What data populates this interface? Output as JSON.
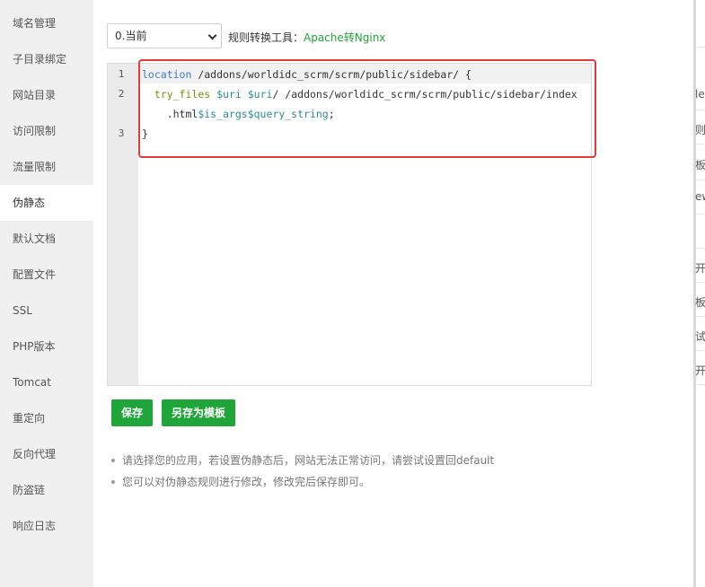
{
  "sidebar": {
    "items": [
      {
        "label": "域名管理"
      },
      {
        "label": "子目录绑定"
      },
      {
        "label": "网站目录"
      },
      {
        "label": "访问限制"
      },
      {
        "label": "流量限制"
      },
      {
        "label": "伪静态",
        "active": true
      },
      {
        "label": "默认文档"
      },
      {
        "label": "配置文件"
      },
      {
        "label": "SSL"
      },
      {
        "label": "PHP版本"
      },
      {
        "label": "Tomcat"
      },
      {
        "label": "重定向"
      },
      {
        "label": "反向代理"
      },
      {
        "label": "防盗链"
      },
      {
        "label": "响应日志"
      }
    ]
  },
  "toolbar": {
    "select_value": "0.当前",
    "tool_label": "规则转换工具：",
    "tool_link": "Apache转Nginx"
  },
  "editor": {
    "line_numbers": [
      "1",
      "2",
      "3"
    ],
    "line1": {
      "kw": "location",
      "rest": " /addons/worldidc_scrm/scrm/public/sidebar/ {"
    },
    "line2": {
      "indent": "  ",
      "fn": "try_files",
      "sp1": " ",
      "v1": "$uri",
      "sp2": " ",
      "v2": "$uri",
      "rest": "/ /addons/worldidc_scrm/scrm/public/sidebar/index"
    },
    "line2b": {
      "prefix": "    .html",
      "v1": "$is_args",
      "v2": "$query_string",
      "end": ";"
    },
    "line3": "}"
  },
  "buttons": {
    "save": "保存",
    "save_template": "另存为模板"
  },
  "tips": [
    "请选择您的应用，若设置伪静态后，网站无法正常访问，请尝试设置回default",
    "您可以对伪静态规则进行修改，修改完后保存即可。"
  ],
  "background_fragments": [
    "lew",
    "则",
    "板",
    "ew",
    "开",
    "板",
    "试",
    "开"
  ],
  "colors": {
    "accent": "#20a53a",
    "highlight": "#e23b3b",
    "sidebar_bg": "#f0f0f0"
  }
}
